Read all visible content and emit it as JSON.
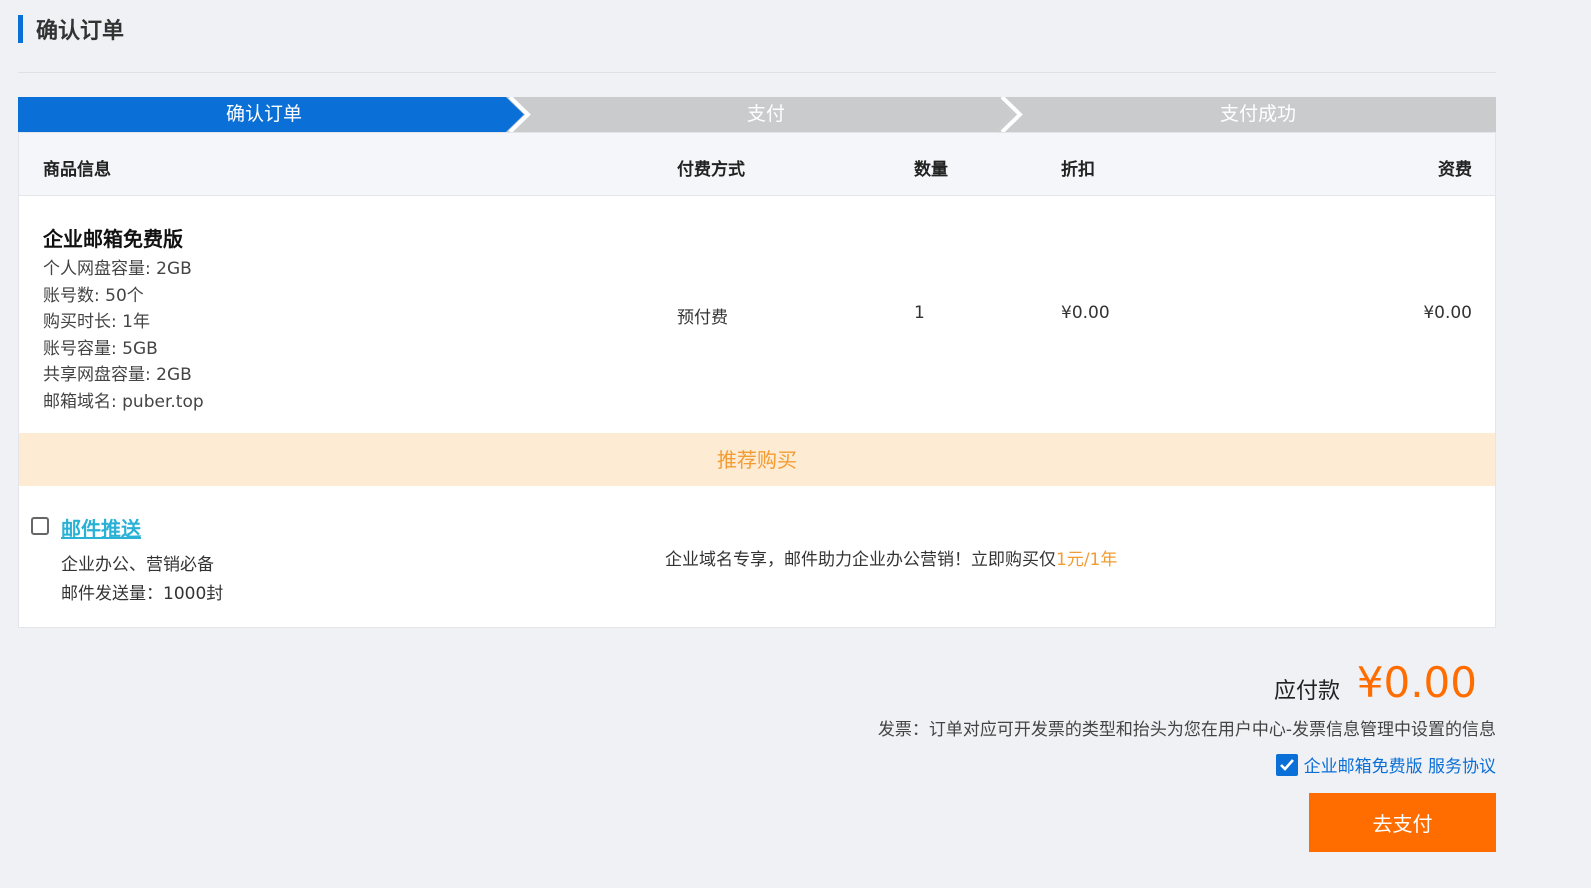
{
  "page": {
    "title": "确认订单"
  },
  "steps": [
    {
      "label": "确认订单",
      "active": true
    },
    {
      "label": "支付",
      "active": false
    },
    {
      "label": "支付成功",
      "active": false
    }
  ],
  "table": {
    "headers": {
      "product": "商品信息",
      "payment": "付费方式",
      "quantity": "数量",
      "discount": "折扣",
      "fee": "资费"
    },
    "row": {
      "product_name": "企业邮箱免费版",
      "specs": [
        "个人网盘容量: 2GB",
        "账号数: 50个",
        "购买时长: 1年",
        "账号容量: 5GB",
        "共享网盘容量: 2GB",
        "邮箱域名: puber.top"
      ],
      "payment": "预付费",
      "quantity": "1",
      "discount": "¥0.00",
      "fee": "¥0.00"
    },
    "recommend_label": "推荐购买",
    "addon": {
      "name": "邮件推送",
      "checked": false,
      "desc": [
        "企业办公、营销必备",
        "邮件发送量：1000封"
      ],
      "promo_text": "企业域名专享，邮件助力企业办公营销！立即购买仅",
      "promo_price": "1元/1年"
    }
  },
  "summary": {
    "total_label": "应付款",
    "total_amount": "¥0.00",
    "invoice_text": "发票：订单对应可开发票的类型和抬头为您在用户中心-发票信息管理中设置的信息",
    "agreement_checked": true,
    "agreement_text": "企业邮箱免费版 服务协议",
    "pay_button": "去支付"
  },
  "colors": {
    "primary": "#0a6fd6",
    "accent": "#ff6d00",
    "recommend_bg": "#fdebd3",
    "recommend_text": "#f29c33",
    "step_inactive": "#cacbcd"
  }
}
